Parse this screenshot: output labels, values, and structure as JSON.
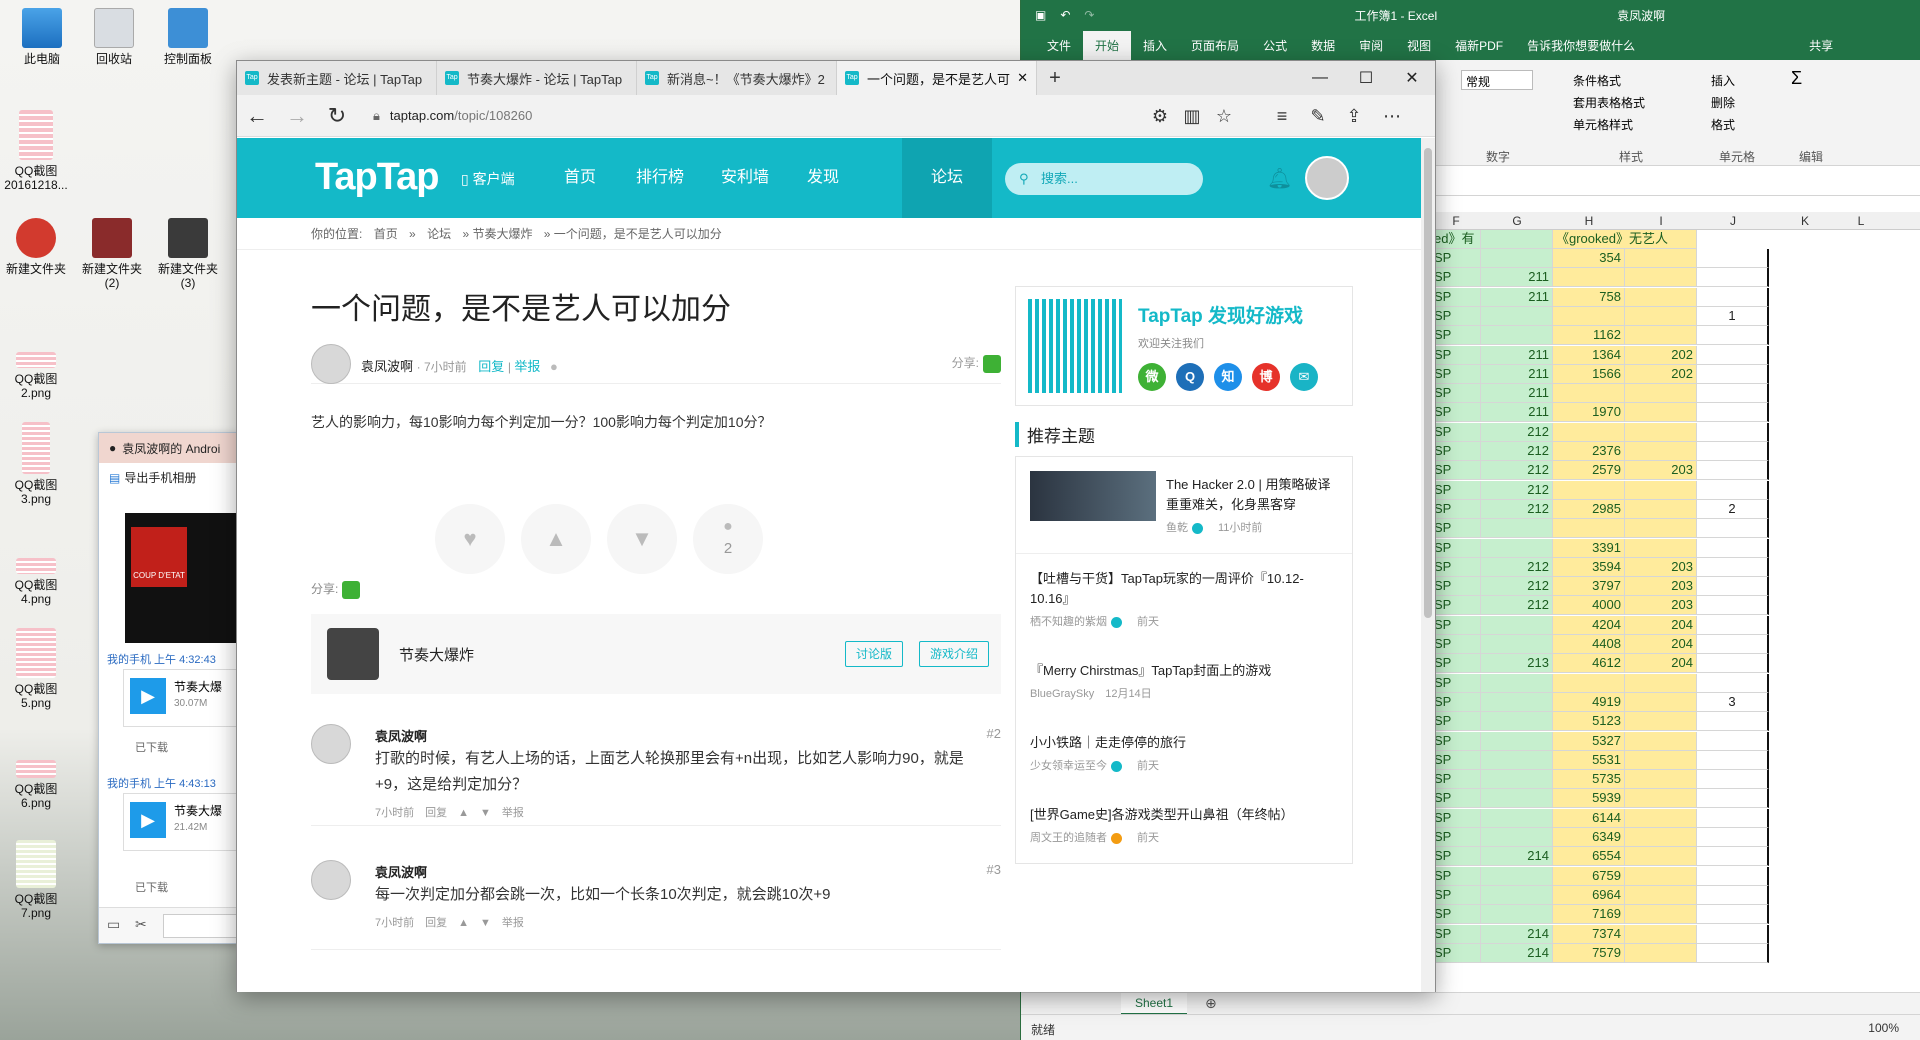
{
  "desktop": {
    "icons": [
      {
        "label": "此电脑"
      },
      {
        "label": "回收站"
      },
      {
        "label": "控制面板"
      },
      {
        "label": "QQ截图20161218..."
      },
      {
        "label": "新建文件夹"
      },
      {
        "label": "新建文件夹(2)"
      },
      {
        "label": "新建文件夹(3)"
      },
      {
        "label": "QQ截图2.png"
      },
      {
        "label": "QQ截图3.png"
      },
      {
        "label": "QQ截图4.png"
      },
      {
        "label": "QQ截图5.png"
      },
      {
        "label": "QQ截图6.png"
      },
      {
        "label": "QQ截图7.png"
      }
    ]
  },
  "excel": {
    "title": "工作簿1 - Excel",
    "user": "袁凤波啊",
    "share": "共享",
    "tabs": [
      "文件",
      "开始",
      "插入",
      "页面布局",
      "公式",
      "数据",
      "审阅",
      "视图",
      "福新PDF"
    ],
    "tell_me": "告诉我你想要做什么",
    "ribbon": {
      "number_format": "常规",
      "cond_format": "条件格式",
      "table_format": "套用表格格式",
      "cell_style": "单元格样式",
      "insert": "插入",
      "delete": "删除",
      "format": "格式",
      "group_number": "数字",
      "group_style": "样式",
      "group_cells": "单元格",
      "group_edit": "编辑"
    },
    "columns": [
      "F",
      "G",
      "H",
      "I",
      "J",
      "K",
      "L"
    ],
    "header_row": {
      "f": "ed》有艺人",
      "h": "《grooked》无艺人"
    },
    "rows": [
      {
        "f": "SP",
        "g": "",
        "h": "354",
        "i": "",
        "j": ""
      },
      {
        "f": "SP",
        "g": "211",
        "h": "",
        "i": "",
        "j": ""
      },
      {
        "f": "SP",
        "g": "211",
        "h": "758",
        "i": "",
        "j": ""
      },
      {
        "f": "SP",
        "g": "",
        "h": "",
        "i": "",
        "j": "1"
      },
      {
        "f": "SP",
        "g": "",
        "h": "1162",
        "i": "",
        "j": ""
      },
      {
        "f": "SP",
        "g": "211",
        "h": "1364",
        "i": "202",
        "j": ""
      },
      {
        "f": "SP",
        "g": "211",
        "h": "1566",
        "i": "202",
        "j": ""
      },
      {
        "f": "SP",
        "g": "211",
        "h": "",
        "i": "",
        "j": ""
      },
      {
        "f": "SP",
        "g": "211",
        "h": "1970",
        "i": "",
        "j": ""
      },
      {
        "f": "SP",
        "g": "212",
        "h": "",
        "i": "",
        "j": ""
      },
      {
        "f": "SP",
        "g": "212",
        "h": "2376",
        "i": "",
        "j": ""
      },
      {
        "f": "SP",
        "g": "212",
        "h": "2579",
        "i": "203",
        "j": ""
      },
      {
        "f": "SP",
        "g": "212",
        "h": "",
        "i": "",
        "j": ""
      },
      {
        "f": "SP",
        "g": "212",
        "h": "2985",
        "i": "",
        "j": "2"
      },
      {
        "f": "SP",
        "g": "",
        "h": "",
        "i": "",
        "j": ""
      },
      {
        "f": "SP",
        "g": "",
        "h": "3391",
        "i": "",
        "j": ""
      },
      {
        "f": "SP",
        "g": "212",
        "h": "3594",
        "i": "203",
        "j": ""
      },
      {
        "f": "SP",
        "g": "212",
        "h": "3797",
        "i": "203",
        "j": ""
      },
      {
        "f": "SP",
        "g": "212",
        "h": "4000",
        "i": "203",
        "j": ""
      },
      {
        "f": "SP",
        "g": "",
        "h": "4204",
        "i": "204",
        "j": ""
      },
      {
        "f": "SP",
        "g": "",
        "h": "4408",
        "i": "204",
        "j": ""
      },
      {
        "f": "SP",
        "g": "213",
        "h": "4612",
        "i": "204",
        "j": ""
      },
      {
        "f": "SP",
        "g": "",
        "h": "",
        "i": "",
        "j": ""
      },
      {
        "f": "SP",
        "g": "",
        "h": "4919",
        "i": "",
        "j": "3"
      },
      {
        "f": "SP",
        "g": "",
        "h": "5123",
        "i": "",
        "j": ""
      },
      {
        "f": "SP",
        "g": "",
        "h": "5327",
        "i": "",
        "j": ""
      },
      {
        "f": "SP",
        "g": "",
        "h": "5531",
        "i": "",
        "j": ""
      },
      {
        "f": "SP",
        "g": "",
        "h": "5735",
        "i": "",
        "j": ""
      },
      {
        "f": "SP",
        "g": "",
        "h": "5939",
        "i": "",
        "j": ""
      },
      {
        "f": "SP",
        "g": "",
        "h": "6144",
        "i": "",
        "j": ""
      },
      {
        "f": "SP",
        "g": "",
        "h": "6349",
        "i": "",
        "j": ""
      },
      {
        "f": "SP",
        "g": "214",
        "h": "6554",
        "i": "",
        "j": ""
      },
      {
        "f": "SP",
        "g": "",
        "h": "6759",
        "i": "",
        "j": ""
      },
      {
        "f": "SP",
        "g": "",
        "h": "6964",
        "i": "",
        "j": ""
      },
      {
        "f": "SP",
        "g": "",
        "h": "7169",
        "i": "",
        "j": ""
      },
      {
        "f": "SP",
        "g": "214",
        "h": "7374",
        "i": "",
        "j": ""
      },
      {
        "f": "SP",
        "g": "214",
        "h": "7579",
        "i": "",
        "j": ""
      }
    ],
    "sheet": "Sheet1",
    "status": "就绪",
    "zoom": "100%"
  },
  "qq": {
    "title": "袁凤波啊的 Androi",
    "export": "导出手机相册",
    "msg1_time": "我的手机  上午 4:32:43",
    "file1_name": "节奏大爆",
    "file1_size": "30.07M",
    "file1_status": "已下载",
    "msg2_time": "我的手机  上午 4:43:13",
    "file2_name": "节奏大爆",
    "file2_size": "21.42M",
    "file2_status": "已下载",
    "album_label": "COUP D'ETAT"
  },
  "browser": {
    "tabs": [
      {
        "title": "发表新主题 - 论坛 | TapTap"
      },
      {
        "title": "节奏大爆炸 - 论坛 | TapTap"
      },
      {
        "title": "新消息~！《节奏大爆炸》2"
      },
      {
        "title": "一个问题，是不是艺人可"
      }
    ],
    "favicon_text": "Tap",
    "url_host": "taptap.com",
    "url_path": "/topic/108260"
  },
  "taptap": {
    "logo": "TapTap",
    "client": "客户端",
    "nav": [
      "首页",
      "排行榜",
      "安利墙",
      "发现",
      "论坛"
    ],
    "search_placeholder": "搜索...",
    "breadcrumb": [
      "你的位置:",
      "首页",
      "论坛",
      "»  节奏大爆炸",
      "»  一个问题，是不是艺人可以加分"
    ],
    "post": {
      "title": "一个问题，是不是艺人可以加分",
      "author": "袁凤波啊",
      "time": "· 7小时前",
      "reply": "回复",
      "report": "举报",
      "share": "分享:",
      "body": "艺人的影响力，每10影响力每个判定加一分？100影响力每个判定加10分？",
      "comment_count": "2"
    },
    "game": {
      "name": "节奏大爆炸",
      "forum_btn": "讨论版",
      "intro_btn": "游戏介绍"
    },
    "replies": [
      {
        "author": "袁凤波啊",
        "floor": "#2",
        "text": "打歌的时候，有艺人上场的话，上面艺人轮换那里会有+n出现，比如艺人影响力90，就是+9，这是给判定加分？",
        "time": "7小时前",
        "reply": "回复",
        "report": "举报"
      },
      {
        "author": "袁凤波啊",
        "floor": "#3",
        "text": "每一次判定加分都会跳一次，比如一个长条10次判定，就会跳10次+9",
        "time": "7小时前",
        "reply": "回复",
        "report": "举报"
      }
    ],
    "sidebar": {
      "qr_title": "TapTap 发现好游戏",
      "qr_sub": "欢迎关注我们",
      "social": [
        "微",
        "Q",
        "知",
        "博",
        "✉"
      ],
      "rec_title": "推荐主题",
      "recs": [
        {
          "title": "The Hacker 2.0 | 用策略破译重重难关，化身黑客穿",
          "author": "鱼乾",
          "time": "11小时前"
        },
        {
          "title": "【吐槽与干货】TapTap玩家的一周评价『10.12-10.16』",
          "author": "栖不知趣的紫烟",
          "time": "前天"
        },
        {
          "title": "『Merry Chirstmas』TapTap封面上的游戏",
          "author": "BlueGraySky",
          "time": "12月14日"
        },
        {
          "title": "小小铁路｜走走停停的旅行",
          "author": "少女领幸运至今",
          "time": "前天"
        },
        {
          "title": "[世界Game史]各游戏类型开山鼻祖（年终帖）",
          "author": "周文王的追随者",
          "time": "前天"
        }
      ]
    }
  }
}
